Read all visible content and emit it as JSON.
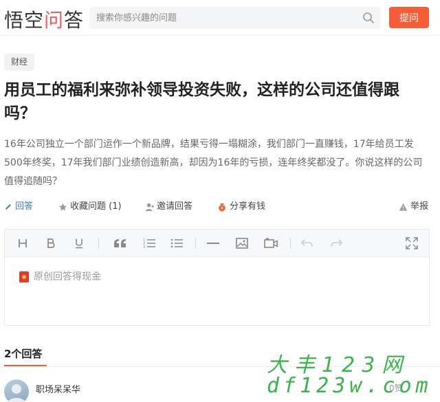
{
  "header": {
    "logo": "悟空问答",
    "search_placeholder": "搜索你感兴趣的问题",
    "ask_label": "提问"
  },
  "question": {
    "tag": "财经",
    "title": "用员工的福利来弥补领导投资失败，这样的公司还值得跟吗？",
    "description": "16年公司独立一个部门运作一个新品牌，结果亏得一塌糊涂，我们部门一直赚钱，17年给员工发500年终奖，17年我们部门业绩创造新高，却因为16年的亏损，连年终奖都没了。你说这样的公司值得追随吗？"
  },
  "actions": {
    "answer": "回答",
    "favorite": "收藏问题 (1)",
    "invite": "邀请回答",
    "share": "分享有钱",
    "report": "举报"
  },
  "editor": {
    "placeholder": "原创回答得现金",
    "tools": [
      "heading-icon",
      "bold-icon",
      "underline-icon",
      "quote-icon",
      "ordered-list-icon",
      "unordered-list-icon",
      "divider-icon",
      "image-icon",
      "video-icon",
      "undo-icon",
      "redo-icon",
      "fullscreen-icon"
    ]
  },
  "answers": {
    "count_label": "2个回答",
    "first": {
      "user": "职场呆呆华",
      "likes": "0赞"
    }
  },
  "watermark": {
    "cn": "大丰123网",
    "en": "df123w.com"
  },
  "colors": {
    "accent": "#f55d36",
    "link": "#3b7ad9",
    "watermark": "#39b54a"
  }
}
